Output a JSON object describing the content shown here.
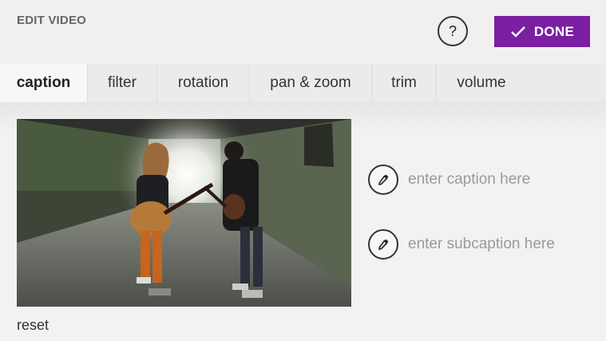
{
  "header": {
    "title": "EDIT VIDEO",
    "help_label": "?",
    "done_label": "DONE",
    "accent_color": "#7b1fa2"
  },
  "tabs": [
    {
      "label": "caption",
      "active": true
    },
    {
      "label": "filter"
    },
    {
      "label": "rotation"
    },
    {
      "label": "pan & zoom"
    },
    {
      "label": "trim"
    },
    {
      "label": "volume"
    }
  ],
  "caption": {
    "placeholder": "enter caption here",
    "value": "",
    "color_picker_icon": "eyedropper-icon"
  },
  "subcaption": {
    "placeholder": "enter subcaption here",
    "value": "",
    "color_picker_icon": "eyedropper-icon"
  },
  "footer": {
    "reset_label": "reset"
  }
}
